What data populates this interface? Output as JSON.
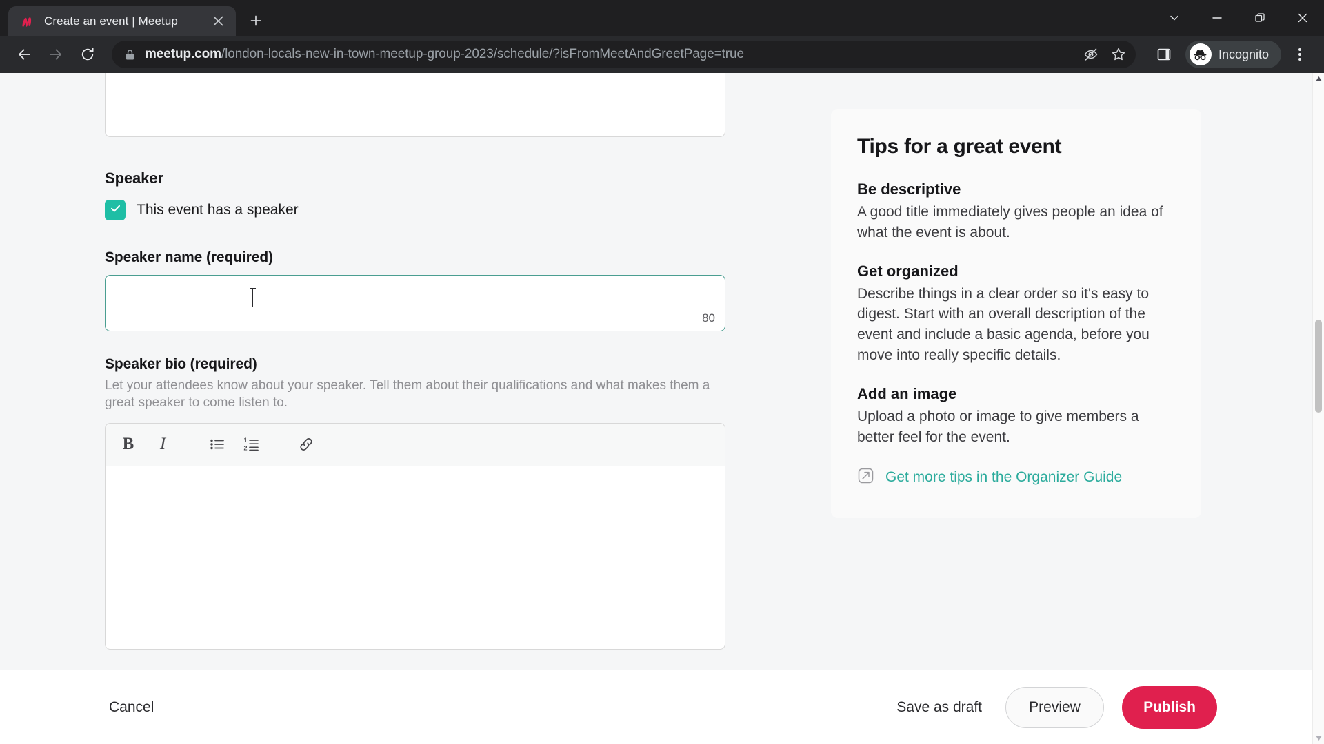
{
  "browser": {
    "tab": {
      "title": "Create an event | Meetup",
      "favicon_icon": "meetup-logo-icon",
      "close_icon": "close-icon"
    },
    "new_tab_icon": "plus-icon",
    "window_controls": [
      {
        "name": "tab-search",
        "icon": "chevron-down-icon"
      },
      {
        "name": "minimize",
        "icon": "minimize-icon"
      },
      {
        "name": "maximize",
        "icon": "restore-window-icon"
      },
      {
        "name": "close",
        "icon": "close-icon"
      }
    ],
    "nav": {
      "back_icon": "arrow-left-icon",
      "forward_icon": "arrow-right-icon",
      "reload_icon": "reload-icon"
    },
    "omnibox": {
      "lock_icon": "lock-icon",
      "host": "meetup.com",
      "path": "/london-locals-new-in-town-meetup-group-2023/schedule/?isFromMeetAndGreetPage=true",
      "tracking_protection_icon": "eye-slash-icon",
      "bookmark_icon": "star-icon"
    },
    "side_panel_icon": "side-panel-icon",
    "profile": {
      "label": "Incognito",
      "icon": "incognito-hat-icon"
    },
    "menu_icon": "three-dot-menu-icon"
  },
  "form": {
    "speaker_section_title": "Speaker",
    "speaker_checkbox": {
      "label": "This event has a speaker",
      "checked": true,
      "check_icon": "checkmark-icon"
    },
    "speaker_name": {
      "label": "Speaker name (required)",
      "value": "",
      "char_count": "80"
    },
    "speaker_bio": {
      "label": "Speaker bio (required)",
      "help": "Let your attendees know about your speaker. Tell them about their qualifications and what makes them a great speaker to come listen to.",
      "value": "",
      "toolbar": [
        {
          "name": "bold",
          "glyph": "B",
          "icon": "bold-icon"
        },
        {
          "name": "italic",
          "glyph": "I",
          "icon": "italic-icon"
        },
        {
          "name": "bullet-list",
          "icon": "bullet-list-icon"
        },
        {
          "name": "numbered-list",
          "icon": "numbered-list-icon"
        },
        {
          "name": "link",
          "icon": "link-icon"
        }
      ]
    }
  },
  "tips": {
    "title": "Tips for a great event",
    "items": [
      {
        "heading": "Be descriptive",
        "body": "A good title immediately gives people an idea of what the event is about."
      },
      {
        "heading": "Get organized",
        "body": "Describe things in a clear order so it's easy to digest. Start with an overall description of the event and include a basic agenda, before you move into really specific details."
      },
      {
        "heading": "Add an image",
        "body": "Upload a photo or image to give members a better feel for the event."
      }
    ],
    "link": {
      "label": "Get more tips in the Organizer Guide",
      "icon": "external-link-icon",
      "color": "#2bab9c"
    }
  },
  "actions": {
    "cancel": "Cancel",
    "save_draft": "Save as draft",
    "preview": "Preview",
    "publish": "Publish",
    "publish_color": "#e0204e"
  },
  "scrollbar": {
    "up_arrow_icon": "caret-up-icon",
    "down_arrow_icon": "caret-down-icon"
  },
  "colors": {
    "accent_teal": "#1ebea5",
    "brand_red": "#e0204e",
    "page_bg": "#f5f6f7"
  }
}
